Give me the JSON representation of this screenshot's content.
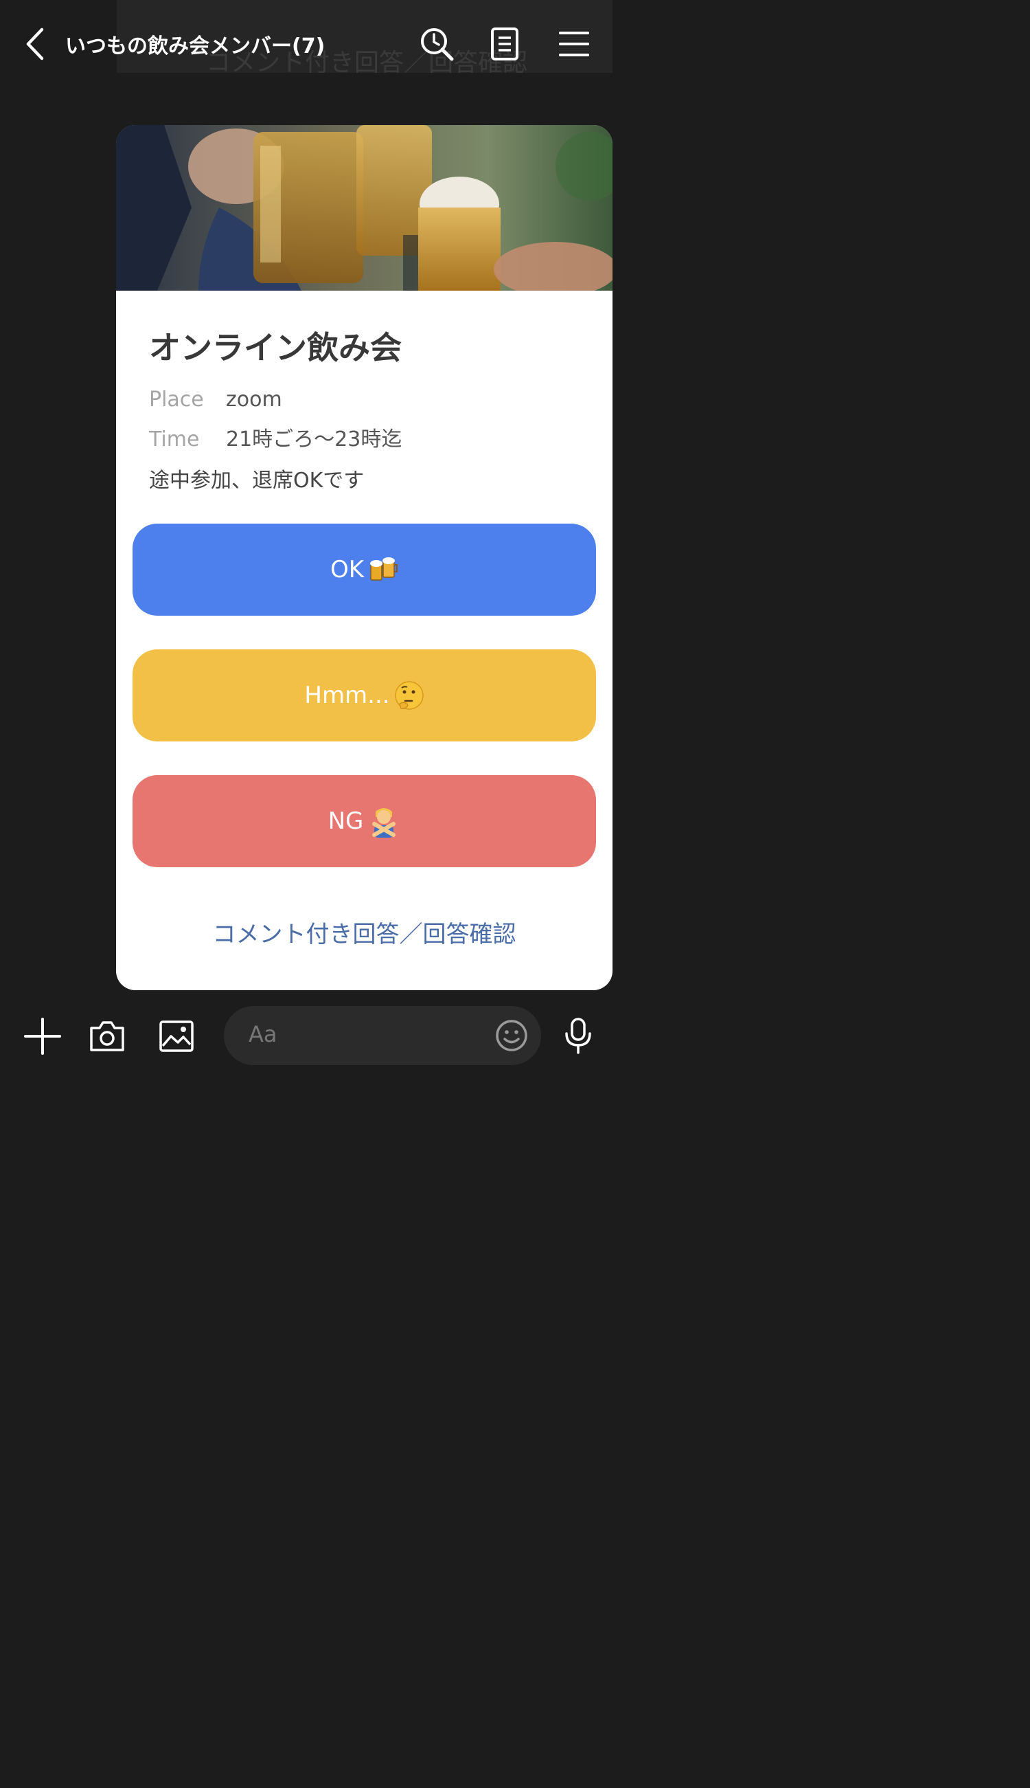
{
  "header": {
    "title": "いつもの飲み会メンバー(7)",
    "ghost_text": "コメント付き回答／回答確認",
    "icons": [
      "back-icon",
      "search-icon",
      "notes-icon",
      "menu-icon"
    ]
  },
  "card": {
    "title": "オンライン飲み会",
    "info": [
      {
        "label": "Place",
        "value": "zoom"
      },
      {
        "label": "Time",
        "value": "21時ごろ〜23時迄"
      }
    ],
    "note": "途中参加、退席OKです",
    "buttons": [
      {
        "label": "OK",
        "emoji": "beer-mugs-icon",
        "color": "#4d80ec"
      },
      {
        "label": "Hmm...",
        "emoji": "thinking-face-icon",
        "color": "#f2c046"
      },
      {
        "label": "NG",
        "emoji": "no-gesture-icon",
        "color": "#e77570"
      }
    ],
    "comment_link": "コメント付き回答／回答確認"
  },
  "bottom_bar": {
    "input_placeholder": "Aa",
    "icons": [
      "plus-icon",
      "camera-icon",
      "image-icon",
      "emoji-icon",
      "microphone-icon"
    ]
  },
  "colors": {
    "background": "#1c1c1c",
    "card": "#ffffff",
    "link": "#4a6ca8"
  }
}
